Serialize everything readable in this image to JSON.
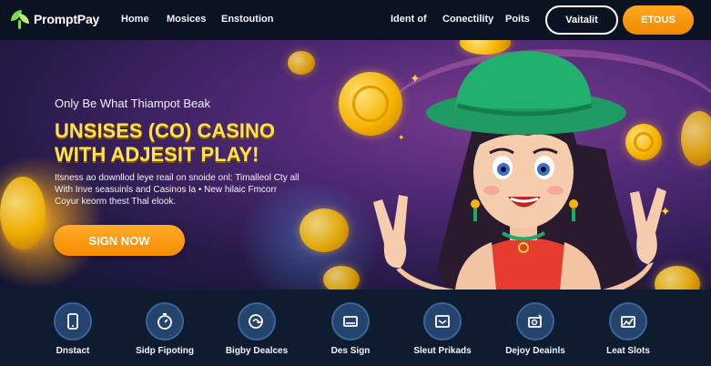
{
  "nav": {
    "brand": "PromptPay",
    "links": [
      "Home",
      "Mosices",
      "Enstoution",
      "Ident of",
      "Conectility",
      "Poits"
    ],
    "outline_button": "Vaitalit",
    "primary_button": "ETOUS"
  },
  "hero": {
    "kicker": "Only Be What Thiampot Beak",
    "title_line1": "UNSISES (CO) CASINO",
    "title_line2": "WITH ADJESIT PLAY!",
    "body": "Itsness ao downllod leye reail on snoide onl: Timalleol Cty all With Inve seasuinls and Casinos la • New hilaic Fmcorr Coyur keorm thest Thal elook.",
    "cta": "SIGN NOW"
  },
  "features": [
    {
      "label": "Dnstact",
      "icon": "phone-icon"
    },
    {
      "label": "Sidp Fipoting",
      "icon": "stopwatch-icon"
    },
    {
      "label": "Bigby Dealces",
      "icon": "payment-icon"
    },
    {
      "label": "Des Sign",
      "icon": "wallet-icon"
    },
    {
      "label": "Sleut Prikads",
      "icon": "inbox-icon"
    },
    {
      "label": "Dejoy Deainls",
      "icon": "gift-icon"
    },
    {
      "label": "Leat Slots",
      "icon": "slots-icon"
    }
  ],
  "colors": {
    "accent_orange": "#f5a623",
    "title_yellow": "#ffe24a",
    "nav_bg": "#0b1222",
    "feature_circle": "#24446e"
  }
}
